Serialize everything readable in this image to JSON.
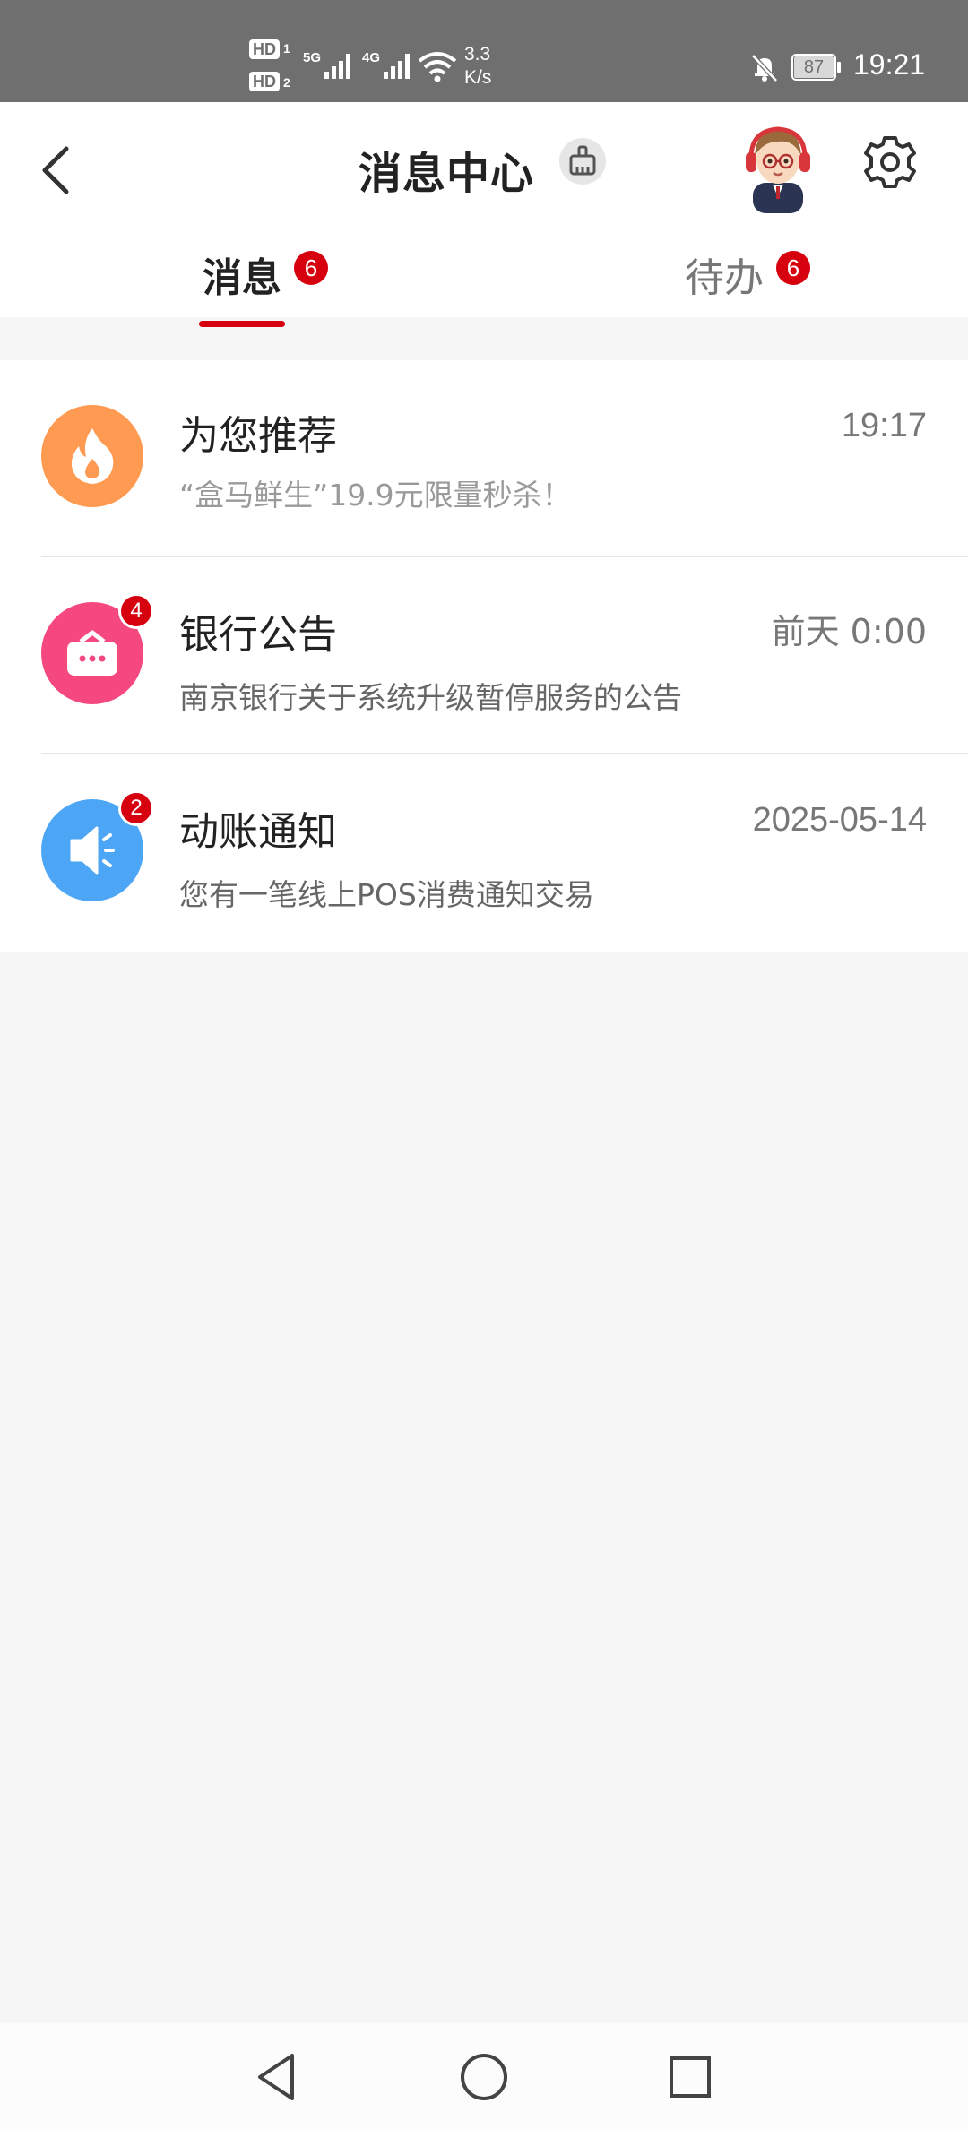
{
  "status_bar": {
    "hd1": "HD",
    "hd1_sub": "1",
    "hd2": "HD",
    "hd2_sub": "2",
    "network1": "5G",
    "network2": "4G",
    "speed_value": "3.3",
    "speed_unit": "K/s",
    "battery": "87",
    "time": "19:21",
    "icons": [
      "signal-icon",
      "wifi-icon",
      "bell-off-icon",
      "battery-icon"
    ]
  },
  "header": {
    "title": "消息中心",
    "icons": [
      "back-icon",
      "broom-icon",
      "avatar",
      "gear-icon"
    ]
  },
  "tabs": [
    {
      "label": "消息",
      "badge": "6",
      "active": true
    },
    {
      "label": "待办",
      "badge": "6",
      "active": false
    }
  ],
  "colors": {
    "accent": "#d7000f",
    "recommend_icon": "#ff9a52",
    "announcement_icon": "#f5487f",
    "notification_icon": "#4da6f5"
  },
  "messages": [
    {
      "title": "为您推荐",
      "time": "19:17",
      "preview": "“盒马鲜生”19.9元限量秒杀！",
      "badge": "",
      "icon": "fire-icon"
    },
    {
      "title": "银行公告",
      "time": "前天 0:00",
      "preview": "南京银行关于系统升级暂停服务的公告",
      "badge": "4",
      "icon": "message-box-icon"
    },
    {
      "title": "动账通知",
      "time": "2025-05-14",
      "preview": "您有一笔线上POS消费通知交易",
      "badge": "2",
      "icon": "speaker-icon"
    }
  ],
  "nav_bar": {
    "icons": [
      "back-triangle-icon",
      "home-circle-icon",
      "recents-square-icon"
    ]
  }
}
